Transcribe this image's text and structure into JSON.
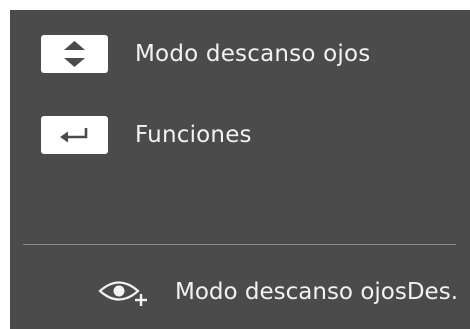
{
  "osd": {
    "background_color": "#4b4b4b",
    "text_color": "#f2f2f2",
    "menu_items": [
      {
        "icon": "up-down-arrows-icon",
        "label": "Modo descanso ojos"
      },
      {
        "icon": "enter-return-icon",
        "label": "Funciones"
      }
    ],
    "status": {
      "icon": "eye-plus-icon",
      "label": "Modo descanso ojos",
      "value": "Des."
    }
  }
}
